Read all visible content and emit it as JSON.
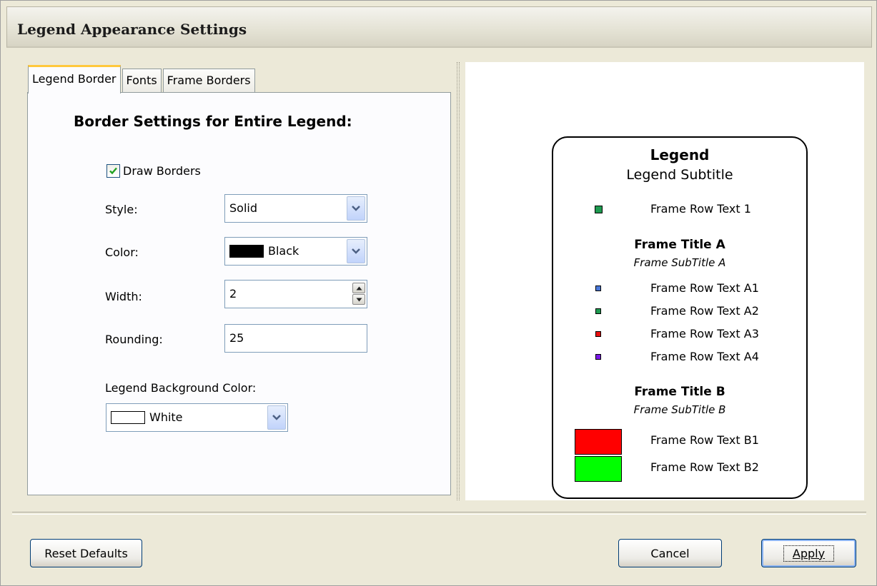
{
  "window": {
    "title": "Legend Appearance Settings"
  },
  "tabs": [
    {
      "label": "Legend Border",
      "active": true
    },
    {
      "label": "Fonts",
      "active": false
    },
    {
      "label": "Frame Borders",
      "active": false
    }
  ],
  "border_panel": {
    "heading": "Border Settings for Entire Legend:",
    "draw_borders": {
      "label": "Draw Borders",
      "checked": true
    },
    "style": {
      "label": "Style:",
      "value": "Solid"
    },
    "color": {
      "label": "Color:",
      "value": "Black",
      "swatch": "#000000"
    },
    "width": {
      "label": "Width:",
      "value": "2"
    },
    "rounding": {
      "label": "Rounding:",
      "value": "25"
    },
    "background": {
      "label": "Legend Background Color:",
      "value": "White",
      "swatch": "#ffffff"
    }
  },
  "preview": {
    "title": "Legend",
    "subtitle": "Legend Subtitle",
    "top_row": {
      "text": "Frame Row Text 1",
      "color": "#1e9a50"
    },
    "frame_a": {
      "title": "Frame Title A",
      "subtitle": "Frame SubTitle A",
      "rows": [
        {
          "text": "Frame Row Text A1",
          "color": "#4a78d8"
        },
        {
          "text": "Frame Row Text A2",
          "color": "#1e9a50"
        },
        {
          "text": "Frame Row Text A3",
          "color": "#e81010"
        },
        {
          "text": "Frame Row Text A4",
          "color": "#7a18e8"
        }
      ]
    },
    "frame_b": {
      "title": "Frame Title B",
      "subtitle": "Frame SubTitle B",
      "rows": [
        {
          "text": "Frame Row Text B1",
          "color": "#ff0000"
        },
        {
          "text": "Frame Row Text B2",
          "color": "#00ff00"
        }
      ]
    }
  },
  "buttons": {
    "reset": "Reset Defaults",
    "cancel": "Cancel",
    "apply": "Apply"
  }
}
